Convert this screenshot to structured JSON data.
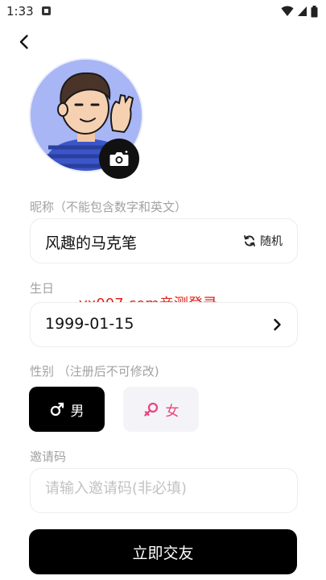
{
  "status_bar": {
    "time": "1:33",
    "icons": [
      "notification-icon",
      "wifi-icon",
      "cellular-signal-icon",
      "battery-icon"
    ]
  },
  "nickname": {
    "label": "昵称（不能包含数字和英文）",
    "value": "风趣的马克笔",
    "random_label": "随机"
  },
  "birthday": {
    "label": "生日",
    "value": "1999-01-15"
  },
  "watermark": "yx007.com亲测登录",
  "gender": {
    "label": "性别 （注册后不可修改)",
    "selected": "男",
    "male_label": "男",
    "female_label": "女"
  },
  "invite": {
    "label": "邀请码",
    "placeholder": "请输入邀请码(非必填)",
    "value": ""
  },
  "submit_label": "立即交友",
  "colors": {
    "accent": "#000000",
    "female": "#e7477a",
    "watermark": "#e0241b",
    "avatar_bg": "#a8b6f6"
  }
}
